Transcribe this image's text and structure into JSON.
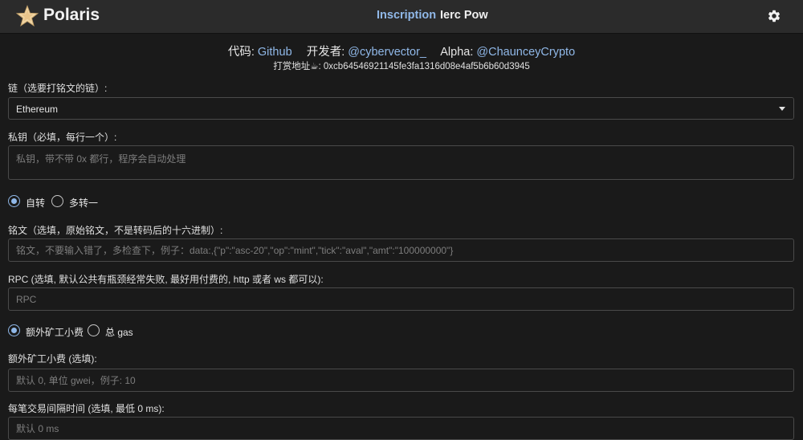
{
  "colors": {
    "accent": "#90b8e8",
    "topbar": "#2b2b2b",
    "background": "#1a1a1a"
  },
  "header": {
    "logo_icon": "star-logo-icon",
    "brand": "Polaris",
    "nav": {
      "inscription": "Inscription",
      "ierc": "Ierc Pow"
    },
    "settings_icon": "gear-icon"
  },
  "credits": {
    "code_label": "代码:",
    "code_link": "Github",
    "dev_label": "开发者:",
    "dev_link": "@cybervector_",
    "alpha_label": "Alpha:",
    "alpha_link": "@ChaunceyCrypto",
    "tip": "打赏地址☕: 0xcb64546921145fe3fa1316d08e4af5b6b60d3945"
  },
  "form": {
    "chain_label": "链（选要打铭文的链）:",
    "chain_value": "Ethereum",
    "private_key_label": "私钥（必填，每行一个）:",
    "private_key_placeholder": "私钥，带不带 0x 都行，程序会自动处理",
    "mode_options": [
      "自转",
      "多转一"
    ],
    "inscription_label": "铭文（选填，原始铭文，不是转码后的十六进制）:",
    "inscription_placeholder": "铭文，不要输入错了，多检查下，例子：data:,{\"p\":\"asc-20\",\"op\":\"mint\",\"tick\":\"aval\",\"amt\":\"100000000\"}",
    "rpc_label": "RPC (选填, 默认公共有瓶颈经常失败, 最好用付费的, http 或者 ws 都可以):",
    "rpc_placeholder": "RPC",
    "gas_options": [
      "额外矿工小费",
      "总 gas"
    ],
    "tip_label": "额外矿工小费 (选填):",
    "tip_placeholder": "默认 0, 单位 gwei，例子: 10",
    "interval_label": "每笔交易间隔时间 (选填, 最低 0 ms):",
    "interval_placeholder": "默认 0 ms"
  }
}
